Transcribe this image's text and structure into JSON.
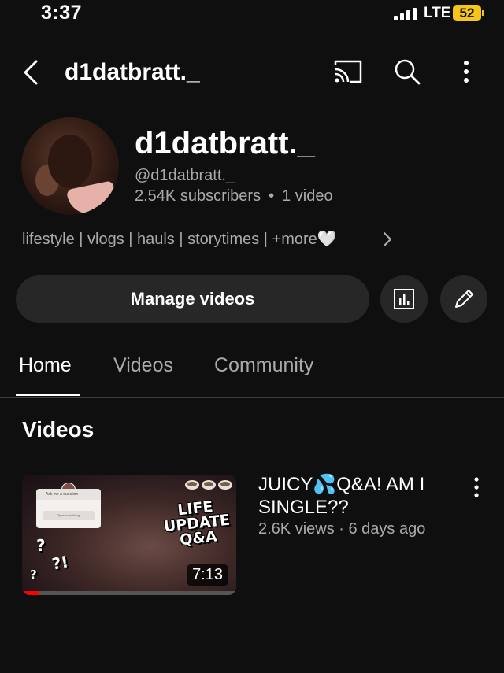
{
  "status_bar": {
    "time": "3:37",
    "network": "LTE",
    "battery": "52",
    "battery_color": "#f5c518"
  },
  "app_bar": {
    "title": "d1datbratt._",
    "icons": [
      "back-icon",
      "cast-icon",
      "search-icon",
      "more-vertical-icon"
    ]
  },
  "channel": {
    "name": "d1datbratt._",
    "handle": "@d1datbratt._",
    "subscribers": "2.54K subscribers",
    "separator": "•",
    "videos": "1 video",
    "description": "lifestyle | vlogs | hauls | storytimes | +more🤍"
  },
  "actions": {
    "manage_label": "Manage videos",
    "icons": [
      "analytics-icon",
      "edit-pencil-icon"
    ]
  },
  "tabs": [
    {
      "label": "Home",
      "active": true
    },
    {
      "label": "Videos",
      "active": false
    },
    {
      "label": "Community",
      "active": false
    }
  ],
  "section": {
    "title": "Videos"
  },
  "video": {
    "title": "JUICY💦Q&A! AM I SINGLE??",
    "meta": "2.6K views · 6 days ago",
    "duration": "7:13",
    "thumbnail_overlay": "LIFE UPDATE Q&A",
    "progress": 0.08,
    "progress_color": "#ff0000",
    "thumbnail_box_text": "Ask me a question",
    "thumbnail_field_text": "Type something"
  },
  "colors": {
    "background": "#0f0f0f",
    "button_bg": "#272727",
    "secondary_text": "#aaaaaa"
  }
}
